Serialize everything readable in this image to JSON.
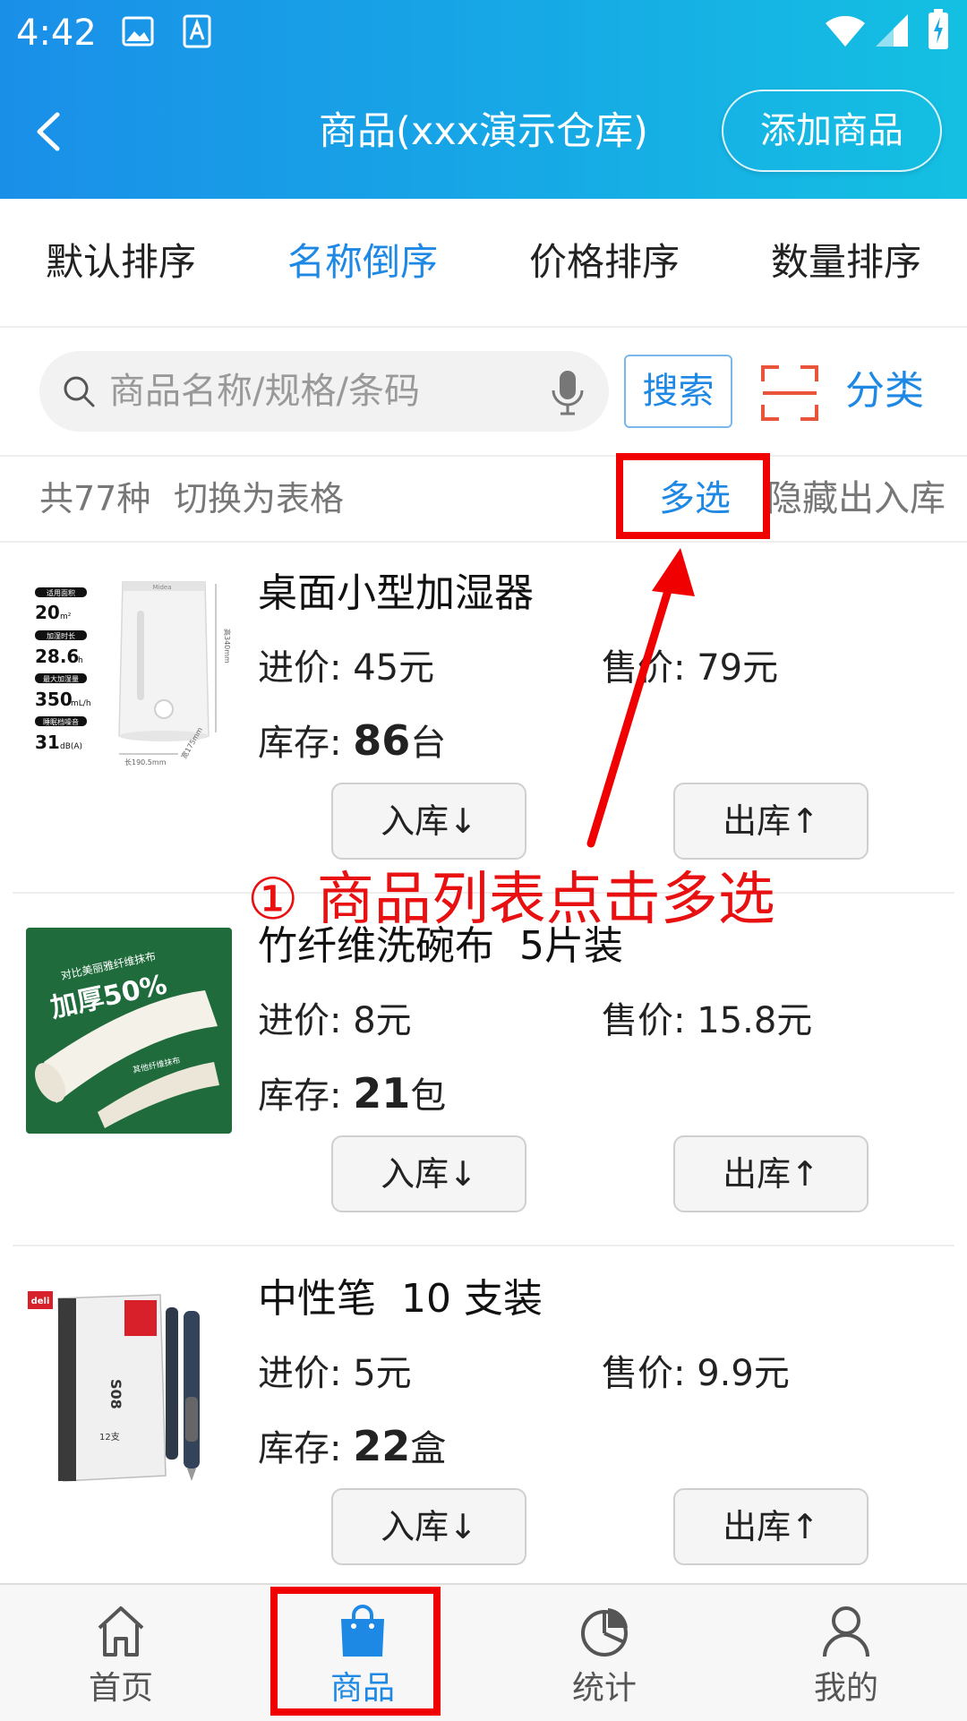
{
  "status_bar": {
    "time": "4:42"
  },
  "header": {
    "title": "商品(xxx演示仓库)",
    "add_button": "添加商品"
  },
  "sort_tabs": [
    {
      "label": "默认排序",
      "active": false
    },
    {
      "label": "名称倒序",
      "active": true
    },
    {
      "label": "价格排序",
      "active": false
    },
    {
      "label": "数量排序",
      "active": false
    }
  ],
  "search": {
    "placeholder": "商品名称/规格/条码",
    "value": "",
    "button": "搜索",
    "category": "分类"
  },
  "info": {
    "total": "共77种",
    "toggle": "切换为表格",
    "multi_select": "多选",
    "hide_stock": "隐藏出入库"
  },
  "products": [
    {
      "name": "桌面小型加湿器",
      "cost_label": "进价:",
      "cost": "45元",
      "price_label": "售价:",
      "price": "79元",
      "stock_label": "库存:",
      "stock": "86",
      "unit": "台",
      "in_button": "入库↓",
      "out_button": "出库↑",
      "image_labels": {
        "area_title": "适用面积",
        "area": "20",
        "area_unit": "m²",
        "duration_title": "加湿时长",
        "duration": "28.6",
        "duration_unit": "h",
        "max_title": "最大加湿量",
        "max": "350",
        "max_unit": "mL/h",
        "noise_title": "睡眠档噪音",
        "noise": "31",
        "noise_unit": "dB(A)",
        "height": "高340mm",
        "length": "长190.5mm",
        "width": "宽175mm",
        "brand": "Midea"
      }
    },
    {
      "name": "竹纤维洗碗布  5片装",
      "cost_label": "进价:",
      "cost": "8元",
      "price_label": "售价:",
      "price": "15.8元",
      "stock_label": "库存:",
      "stock": "21",
      "unit": "包",
      "in_button": "入库↓",
      "out_button": "出库↑",
      "image_labels": {
        "headline": "对比美丽雅纤维抹布",
        "big": "加厚50%",
        "caption": "其他纤维抹布"
      }
    },
    {
      "name": "中性笔  10 支装",
      "cost_label": "进价:",
      "cost": "5元",
      "price_label": "售价:",
      "price": "9.9元",
      "stock_label": "库存:",
      "stock": "22",
      "unit": "盒",
      "in_button": "入库↓",
      "out_button": "出库↑",
      "image_labels": {
        "brand": "deli",
        "model": "S08",
        "count": "12支"
      }
    }
  ],
  "annotation": {
    "text": "① 商品列表点击多选",
    "color": "#e81010"
  },
  "bottom_nav": [
    {
      "label": "首页",
      "icon": "home-icon",
      "active": false
    },
    {
      "label": "商品",
      "icon": "shopping-bag-icon",
      "active": true
    },
    {
      "label": "统计",
      "icon": "pie-chart-icon",
      "active": false
    },
    {
      "label": "我的",
      "icon": "user-icon",
      "active": false
    }
  ],
  "colors": {
    "accent": "#1e88e5",
    "header_start": "#1a8fe8",
    "header_end": "#14c0e2",
    "highlight": "#f00000"
  }
}
